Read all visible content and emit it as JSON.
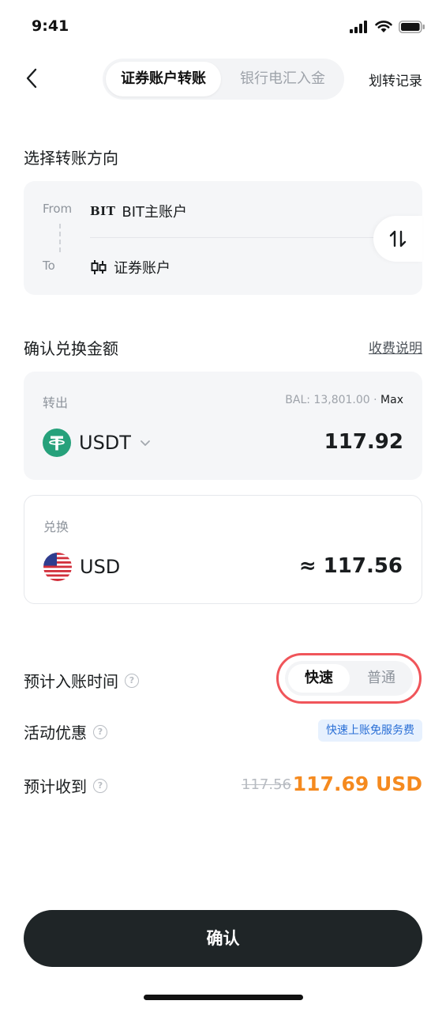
{
  "status_bar": {
    "time": "9:41"
  },
  "nav": {
    "tabs": [
      {
        "label": "证券账户转账",
        "active": true
      },
      {
        "label": "银行电汇入金",
        "active": false
      }
    ],
    "right_link": "划转记录"
  },
  "direction": {
    "title": "选择转账方向",
    "from_label": "From",
    "from_logo": "BIT",
    "from_value": "BIT主账户",
    "to_label": "To",
    "to_value": "证券账户"
  },
  "amount_section": {
    "title": "确认兑换金额",
    "fee_link": "收费说明",
    "out": {
      "label": "转出",
      "balance": "BAL: 13,801.00",
      "balance_sep": "·",
      "max_label": "Max",
      "currency": "USDT",
      "amount": "117.92"
    },
    "in": {
      "label": "兑换",
      "currency": "USD",
      "amount": "≈ 117.56"
    }
  },
  "details": {
    "eta_label": "预计入账时间",
    "speed_options": [
      {
        "label": "快速",
        "active": true
      },
      {
        "label": "普通",
        "active": false
      }
    ],
    "promo_label": "活动优惠",
    "promo_badge": "快速上账免服务费",
    "receive_label": "预计收到",
    "old_amount": "117.56",
    "receive_amount": "117.69 USD"
  },
  "confirm_label": "确认",
  "colors": {
    "accent_orange": "#f58a1f",
    "highlight_red": "#f0555a",
    "badge_blue": "#2a6fd6",
    "usdt_green": "#26a17b",
    "button_dark": "#1f2527"
  }
}
